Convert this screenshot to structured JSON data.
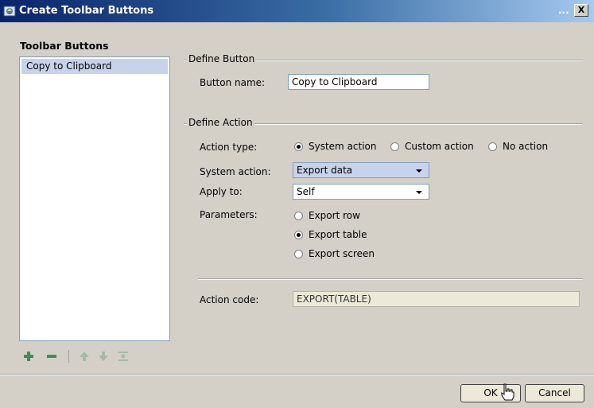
{
  "window": {
    "title": "Create Toolbar Buttons",
    "title_ellipsis": "...",
    "close_label": "X"
  },
  "left_panel": {
    "header": "Toolbar Buttons",
    "items": [
      {
        "label": "Copy to Clipboard",
        "selected": true
      }
    ],
    "toolbar_icons": [
      "add-icon",
      "remove-icon",
      "move-up-icon",
      "move-down-icon",
      "distribute-icon"
    ]
  },
  "define_button": {
    "group_label": "Define Button",
    "name_label": "Button name:",
    "name_value": "Copy to Clipboard"
  },
  "define_action": {
    "group_label": "Define Action",
    "action_type_label": "Action type:",
    "action_types": [
      {
        "label": "System action",
        "checked": true
      },
      {
        "label": "Custom action",
        "checked": false
      },
      {
        "label": "No action",
        "checked": false
      }
    ],
    "system_action_label": "System action:",
    "system_action_value": "Export data",
    "apply_to_label": "Apply to:",
    "apply_to_value": "Self",
    "parameters_label": "Parameters:",
    "parameters": [
      {
        "label": "Export row",
        "checked": false
      },
      {
        "label": "Export table",
        "checked": true
      },
      {
        "label": "Export screen",
        "checked": false
      }
    ],
    "action_code_label": "Action code:",
    "action_code_value": "EXPORT(TABLE)"
  },
  "footer": {
    "ok_label": "OK",
    "cancel_label": "Cancel"
  },
  "colors": {
    "titlebar_start": "#0a246a",
    "titlebar_end": "#a6caf0",
    "selection": "#c6d3ea",
    "dialog_bg": "#d4d0c8",
    "icon_green": "#2f8f4e"
  }
}
